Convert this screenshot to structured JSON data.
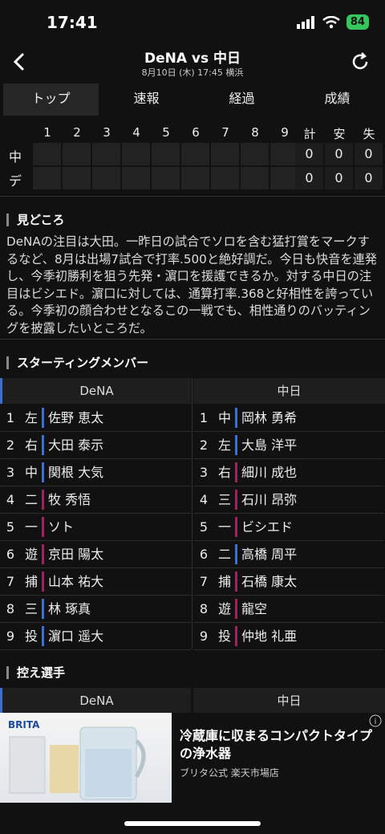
{
  "status": {
    "time": "17:41",
    "battery": "84"
  },
  "header": {
    "title": "DeNA vs 中日",
    "subtitle": "8月10日 (木) 17:45 横浜"
  },
  "tabs": [
    "トップ",
    "速報",
    "経過",
    "成績"
  ],
  "scoreboard": {
    "innings": [
      "1",
      "2",
      "3",
      "4",
      "5",
      "6",
      "7",
      "8",
      "9"
    ],
    "totals_headers": [
      "計",
      "安",
      "失"
    ],
    "teams": [
      {
        "abbr": "中",
        "totals": [
          "0",
          "0",
          "0"
        ]
      },
      {
        "abbr": "デ",
        "totals": [
          "0",
          "0",
          "0"
        ]
      }
    ]
  },
  "midokoro": {
    "title": "見どころ",
    "text": "DeNAの注目は大田。一昨日の試合でソロを含む猛打賞をマークするなど、8月は出場7試合で打率.500と絶好調だ。今日も快音を連発し、今季初勝利を狙う先発・濵口を援護できるか。対する中日の注目はビシエド。濵口に対しては、通算打率.368と好相性を誇っている。今季初の顔合わせとなるこの一戦でも、相性通りのバッティングを披露したいところだ。"
  },
  "starting": {
    "title": "スターティングメンバー",
    "home_team": "DeNA",
    "away_team": "中日",
    "dena": [
      {
        "n": "1",
        "pos": "左",
        "name": "佐野 恵太",
        "c": "#3b6fd1"
      },
      {
        "n": "2",
        "pos": "右",
        "name": "大田 泰示",
        "c": "#3b6fd1"
      },
      {
        "n": "3",
        "pos": "中",
        "name": "関根 大気",
        "c": "#3b6fd1"
      },
      {
        "n": "4",
        "pos": "二",
        "name": "牧 秀悟",
        "c": "#a02060"
      },
      {
        "n": "5",
        "pos": "一",
        "name": "ソト",
        "c": "#a02060"
      },
      {
        "n": "6",
        "pos": "遊",
        "name": "京田 陽太",
        "c": "#a02060"
      },
      {
        "n": "7",
        "pos": "捕",
        "name": "山本 祐大",
        "c": "#a02060"
      },
      {
        "n": "8",
        "pos": "三",
        "name": "林 琢真",
        "c": "#3b6fd1"
      },
      {
        "n": "9",
        "pos": "投",
        "name": "濵口 遥大",
        "c": "#3b6fd1"
      }
    ],
    "chunichi": [
      {
        "n": "1",
        "pos": "中",
        "name": "岡林 勇希",
        "c": "#3b6fd1"
      },
      {
        "n": "2",
        "pos": "左",
        "name": "大島 洋平",
        "c": "#3b6fd1"
      },
      {
        "n": "3",
        "pos": "右",
        "name": "細川 成也",
        "c": "#a02060"
      },
      {
        "n": "4",
        "pos": "三",
        "name": "石川 昂弥",
        "c": "#a02060"
      },
      {
        "n": "5",
        "pos": "一",
        "name": "ビシエド",
        "c": "#a02060"
      },
      {
        "n": "6",
        "pos": "二",
        "name": "高橋 周平",
        "c": "#3b6fd1"
      },
      {
        "n": "7",
        "pos": "捕",
        "name": "石橋 康太",
        "c": "#a02060"
      },
      {
        "n": "8",
        "pos": "遊",
        "name": "龍空",
        "c": "#a02060"
      },
      {
        "n": "9",
        "pos": "投",
        "name": "仲地 礼亜",
        "c": "#a02060"
      }
    ]
  },
  "reserves": {
    "title": "控え選手",
    "home_team": "DeNA",
    "away_team": "中日"
  },
  "ad": {
    "brand": "BRITA",
    "headline": "冷蔵庫に収まるコンパクトタイプの浄水器",
    "source": "ブリタ公式 楽天市場店"
  }
}
